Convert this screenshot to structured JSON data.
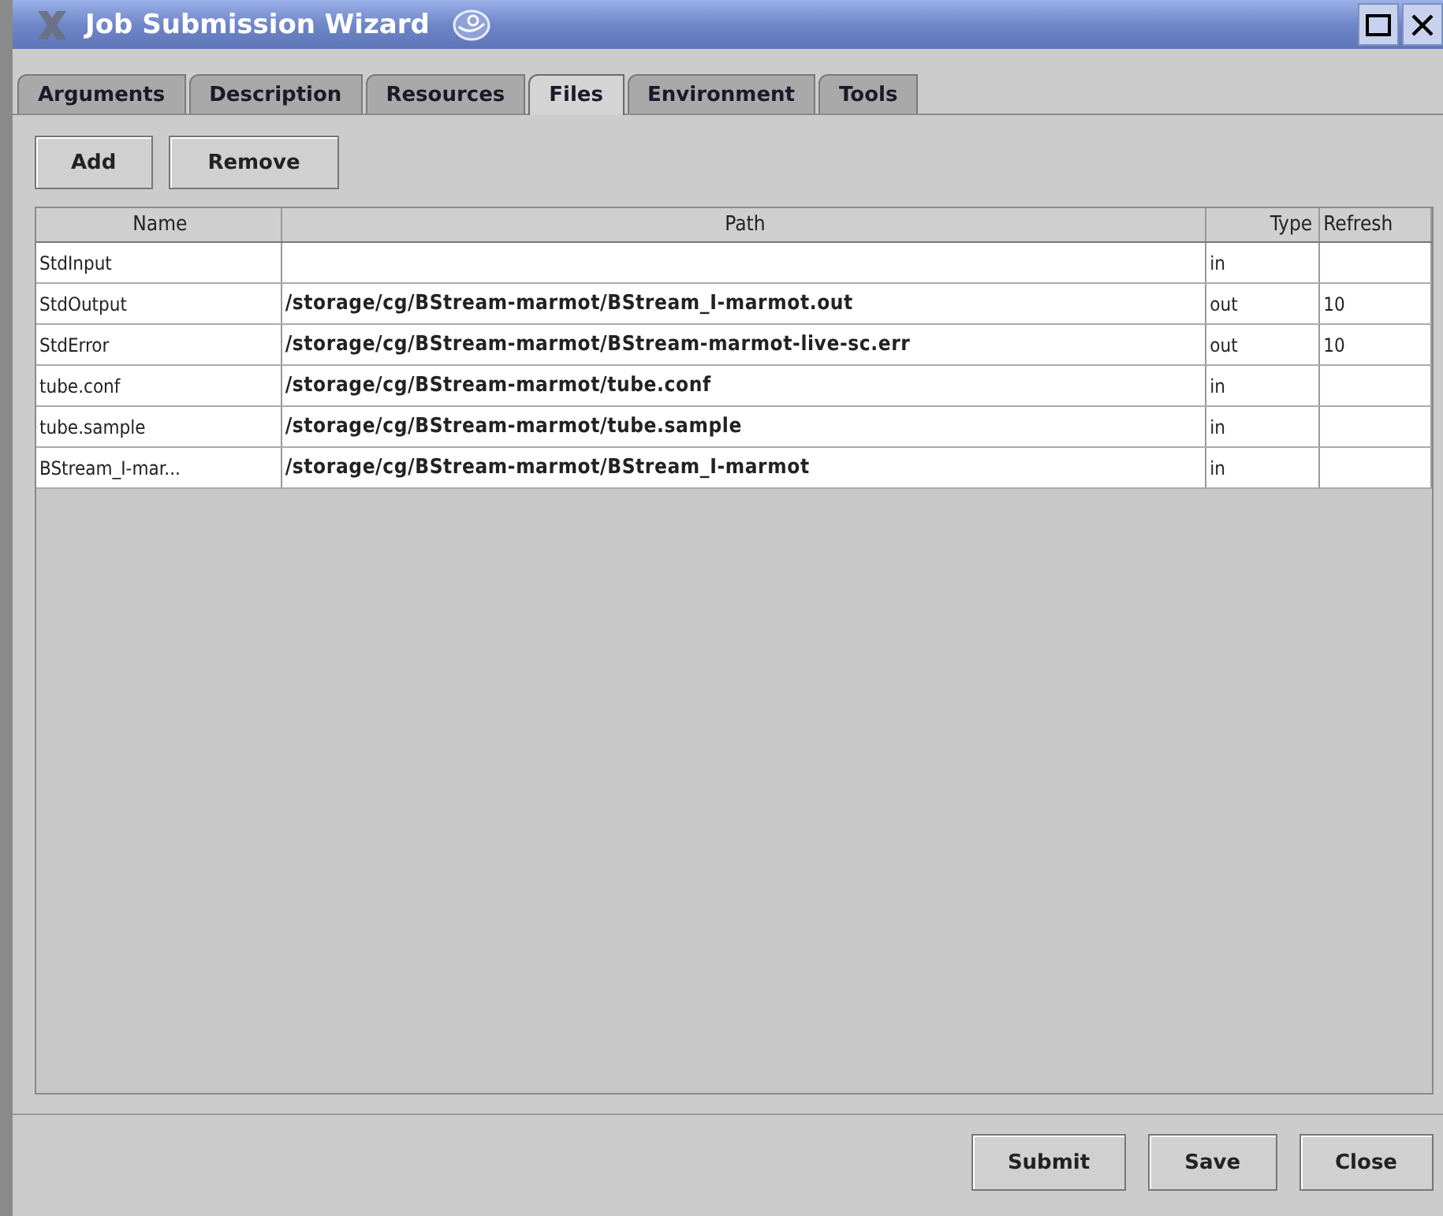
{
  "window": {
    "title": "Job Submission Wizard"
  },
  "tabs": [
    {
      "label": "Arguments",
      "selected": false
    },
    {
      "label": "Description",
      "selected": false
    },
    {
      "label": "Resources",
      "selected": false
    },
    {
      "label": "Files",
      "selected": true
    },
    {
      "label": "Environment",
      "selected": false
    },
    {
      "label": "Tools",
      "selected": false
    }
  ],
  "toolbar": [
    "Add",
    "Remove"
  ],
  "table": {
    "columns": [
      "Name",
      "Path",
      "Type",
      "Refresh"
    ],
    "rows": [
      [
        "StdInput",
        "",
        "in",
        ""
      ],
      [
        "StdOutput",
        "/storage/cg/BStream-marmot/BStream_I-marmot.out",
        "out",
        "10"
      ],
      [
        "StdError",
        "/storage/cg/BStream-marmot/BStream-marmot-live-sc.err",
        "out",
        "10"
      ],
      [
        "tube.conf",
        "/storage/cg/BStream-marmot/tube.conf",
        "in",
        ""
      ],
      [
        "tube.sample",
        "/storage/cg/BStream-marmot/tube.sample",
        "in",
        ""
      ],
      [
        "BStream_I-mar...",
        "/storage/cg/BStream-marmot/BStream_I-marmot",
        "in",
        ""
      ]
    ]
  },
  "buttons": [
    "Submit",
    "Save",
    "Close"
  ]
}
